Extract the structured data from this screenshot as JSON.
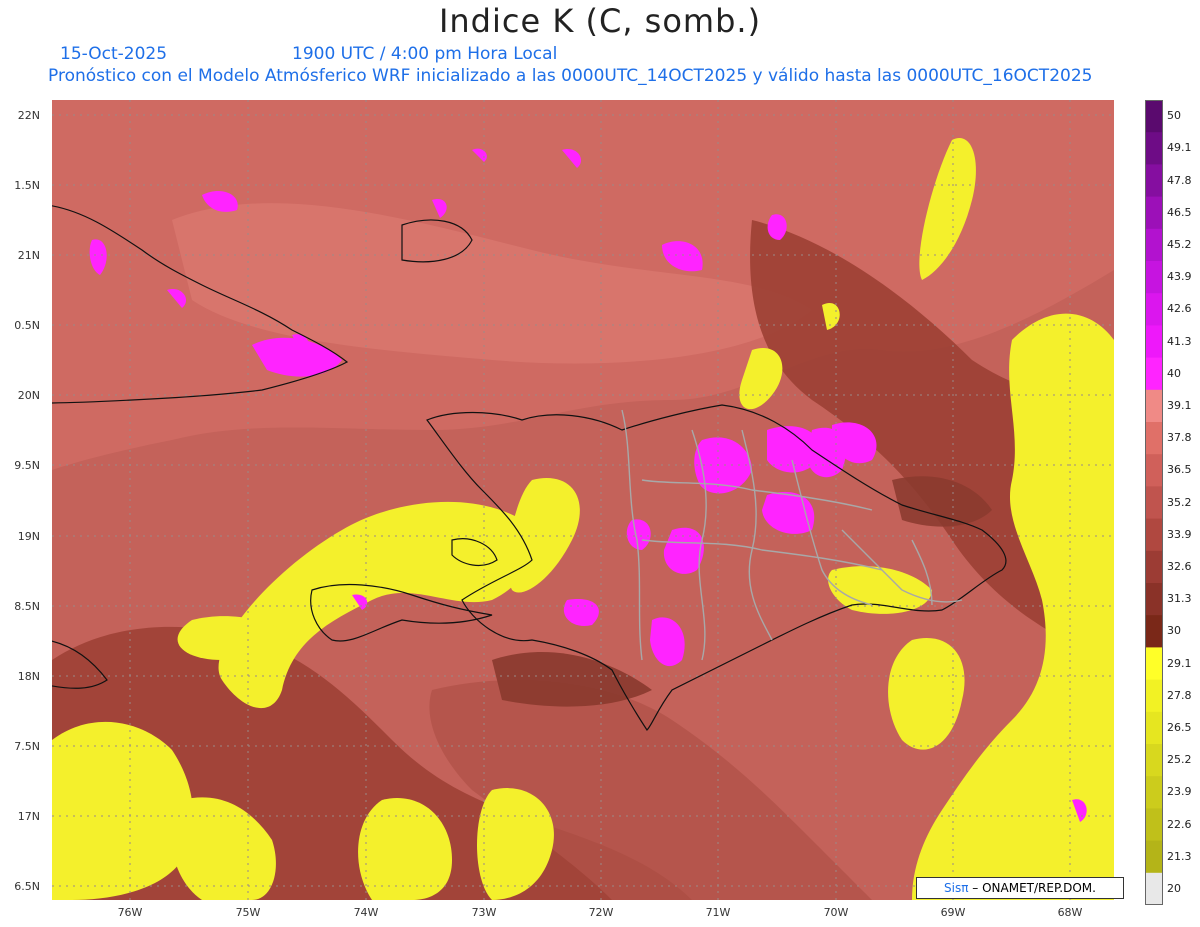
{
  "title": "Indice K (C, somb.)",
  "date": "15-Oct-2025",
  "time": "1900 UTC / 4:00 pm Hora Local",
  "forecast": "Pronóstico con el Modelo Atmósferico WRF inicializado a las 0000UTC_14OCT2025 y válido hasta las  0000UTC_16OCT2025",
  "lat_labels": [
    "22N",
    "1.5N",
    "21N",
    "0.5N",
    "20N",
    "9.5N",
    "19N",
    "8.5N",
    "18N",
    "7.5N",
    "17N",
    "6.5N"
  ],
  "lon_labels": [
    "76W",
    "75W",
    "74W",
    "73W",
    "72W",
    "71W",
    "70W",
    "69W",
    "68W"
  ],
  "colorbar": {
    "labels": [
      "50",
      "49.1",
      "47.8",
      "46.5",
      "45.2",
      "43.9",
      "42.6",
      "41.3",
      "40",
      "39.1",
      "37.8",
      "36.5",
      "35.2",
      "33.9",
      "32.6",
      "31.3",
      "30",
      "29.1",
      "27.8",
      "26.5",
      "25.2",
      "23.9",
      "22.6",
      "21.3",
      "20"
    ],
    "colors": [
      "#5a0a6e",
      "#6e0c86",
      "#850ea0",
      "#9c10b8",
      "#b212cf",
      "#c614e0",
      "#db16ee",
      "#ee18fa",
      "#ff24ff",
      "#f08a86",
      "#e07068",
      "#d0605a",
      "#c0544e",
      "#b04840",
      "#9c3c34",
      "#8a3228",
      "#7a2818",
      "#ffff28",
      "#f2f224",
      "#e6e620",
      "#d8d81e",
      "#cccc1c",
      "#c0c01a",
      "#b4b418",
      "#e8e8e8"
    ]
  },
  "colors": {
    "ocean_k": "#b85a4e",
    "land_k": "#d77068",
    "low_k": "#f0f030",
    "high_k": "#ff24ff",
    "dark_k": "#8a3a2e",
    "subtitle": "#1e6fe8"
  },
  "credit": {
    "logo": "Sisπ",
    "text": "– ONAMET/REP.DOM."
  }
}
